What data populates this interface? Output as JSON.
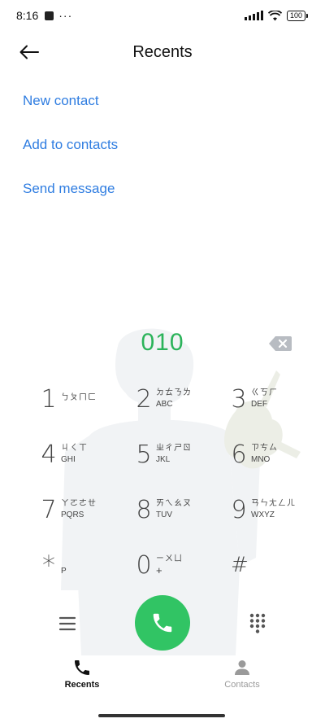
{
  "status_bar": {
    "time": "8:16",
    "more": "···",
    "battery": "100"
  },
  "header": {
    "title": "Recents",
    "back_icon": "arrow-left-icon"
  },
  "actions": {
    "new_contact": "New contact",
    "add_to_contacts": "Add to contacts",
    "send_message": "Send message",
    "color": "#2f7de1"
  },
  "dialer": {
    "number": "010",
    "number_color": "#2bb35a",
    "backspace_icon": "backspace-icon"
  },
  "keypad": {
    "keys": [
      {
        "digit": "1",
        "zhuyin": "ㄅㄆㄇㄈ",
        "letters": ""
      },
      {
        "digit": "2",
        "zhuyin": "ㄉㄊㄋㄌ",
        "letters": "ABC"
      },
      {
        "digit": "3",
        "zhuyin": "ㄍㄎㄏ",
        "letters": "DEF"
      },
      {
        "digit": "4",
        "zhuyin": "ㄐㄑㄒ",
        "letters": "GHI"
      },
      {
        "digit": "5",
        "zhuyin": "ㄓㄔㄕㄖ",
        "letters": "JKL"
      },
      {
        "digit": "6",
        "zhuyin": "ㄗㄘㄙ",
        "letters": "MNO"
      },
      {
        "digit": "7",
        "zhuyin": "ㄚㄛㄜㄝ",
        "letters": "PQRS"
      },
      {
        "digit": "8",
        "zhuyin": "ㄞㄟㄠㄡ",
        "letters": "TUV"
      },
      {
        "digit": "9",
        "zhuyin": "ㄢㄣㄤㄥㄦ",
        "letters": "WXYZ"
      },
      {
        "digit": "*",
        "zhuyin": "",
        "letters": "P"
      },
      {
        "digit": "0",
        "zhuyin": "ㄧㄨㄩ",
        "letters": "+"
      },
      {
        "digit": "#",
        "zhuyin": "",
        "letters": ""
      }
    ]
  },
  "controls": {
    "menu_icon": "menu-icon",
    "call_icon": "phone-icon",
    "call_color": "#31c464",
    "dialpad_icon": "dialpad-icon"
  },
  "bottom_nav": {
    "recents_label": "Recents",
    "contacts_label": "Contacts",
    "recents_icon": "phone-icon",
    "contacts_icon": "person-icon"
  }
}
